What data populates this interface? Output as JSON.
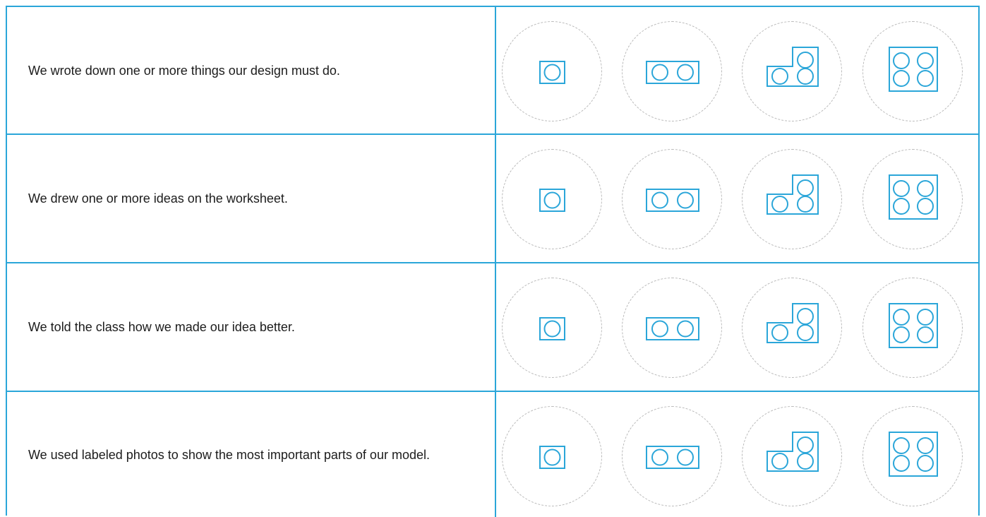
{
  "rubric": {
    "criteria": [
      {
        "text": "We wrote down one or more things our design must do."
      },
      {
        "text": "We drew one or more ideas on the worksheet."
      },
      {
        "text": "We told the class how we made our idea better."
      },
      {
        "text": "We used labeled photos to show the most important parts of our model."
      }
    ],
    "levels": [
      {
        "icon": "one-stud-brick-icon",
        "studs": 1
      },
      {
        "icon": "two-stud-brick-icon",
        "studs": 2
      },
      {
        "icon": "three-stud-brick-icon",
        "studs": 3
      },
      {
        "icon": "four-stud-brick-icon",
        "studs": 4
      }
    ],
    "colors": {
      "accent": "#2ba6d9",
      "dashed_circle": "#b9b9b9",
      "text": "#1c1c1c"
    }
  }
}
